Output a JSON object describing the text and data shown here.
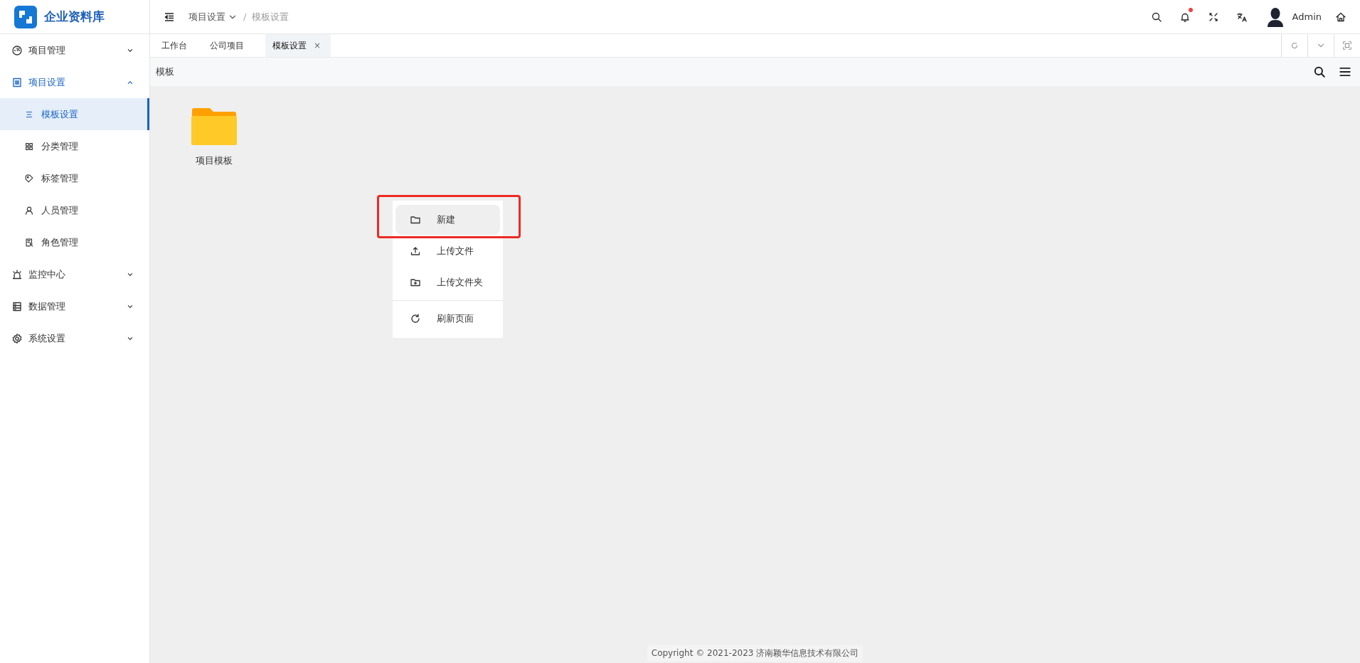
{
  "app": {
    "name": "企业资料库"
  },
  "header": {
    "breadcrumb": {
      "parent": "项目设置",
      "separator": "/",
      "current": "模板设置"
    },
    "notification_dot": true,
    "user": "Admin"
  },
  "sidebar": {
    "items": [
      {
        "label": "项目管理",
        "expanded": false,
        "selected": false
      },
      {
        "label": "项目设置",
        "expanded": true,
        "selected": true,
        "children": [
          {
            "label": "模板设置",
            "selected": true
          },
          {
            "label": "分类管理",
            "selected": false
          },
          {
            "label": "标签管理",
            "selected": false
          },
          {
            "label": "人员管理",
            "selected": false
          },
          {
            "label": "角色管理",
            "selected": false
          }
        ]
      },
      {
        "label": "监控中心",
        "expanded": false,
        "selected": false
      },
      {
        "label": "数据管理",
        "expanded": false,
        "selected": false
      },
      {
        "label": "系统设置",
        "expanded": false,
        "selected": false
      }
    ]
  },
  "tabs": [
    {
      "label": "工作台",
      "selected": false
    },
    {
      "label": "公司项目",
      "selected": false
    },
    {
      "label": "模板设置",
      "selected": true,
      "close": "×"
    }
  ],
  "toolbar": {
    "title": "模板"
  },
  "files": [
    {
      "name": "项目模板"
    }
  ],
  "context_menu": {
    "highlighted_outline": true,
    "items": [
      {
        "label": "新建",
        "selected": true
      },
      {
        "label": "上传文件",
        "selected": false
      },
      {
        "label": "上传文件夹",
        "selected": false
      },
      {
        "label": "刷新页面",
        "selected": false,
        "divider_before": true
      }
    ]
  },
  "footer": {
    "copyright": "Copyright © 2021-2023 济南颖华信息技术有限公司"
  }
}
